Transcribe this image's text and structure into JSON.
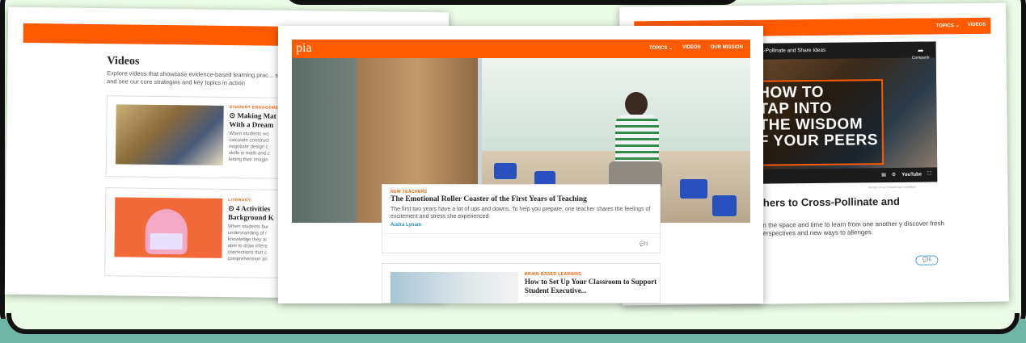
{
  "left_page": {
    "section_title": "Videos",
    "section_desc": "Explore videos that showcase evidence-based learning prac... schools, and see our core strategies and key topics in action",
    "cards": [
      {
        "category": "STUDENT ENGAGEMENT",
        "title_lines": [
          "⊙ Making Mat",
          "With a Dream"
        ],
        "text_lines": [
          "When students wo",
          "calculate construct",
          "negotiate design c",
          "skills in math and c",
          "letting their imagin"
        ]
      },
      {
        "category": "LITERACY",
        "title_lines": [
          "⊙ 4 Activities",
          "Background K"
        ],
        "text_lines": [
          "When students bui",
          "understanding of r",
          "knowledge they al",
          "able to draw infere",
          "connections that c",
          "comprehension an"
        ]
      }
    ]
  },
  "center_page": {
    "logo": "pia",
    "nav": [
      "TOPICS ⌄",
      "VIDEOS",
      "OUR MISSION"
    ],
    "featured": {
      "category": "NEW TEACHERS",
      "title": "The Emotional Roller Coaster of the First Years of Teaching",
      "text": "The first two years have a lot of ups and downs. To help you prepare, one teacher shares the feelings of excitement and stress she experienced.",
      "author": "Audra Lynam",
      "comments": "1"
    },
    "second": {
      "category": "BRAIN-BASED LEARNING",
      "title": "How to Set Up Your Classroom to Support Student Executive..."
    }
  },
  "right_page": {
    "nav": [
      "TOPICS ⌄",
      "VIDEOS"
    ],
    "video": {
      "top_title": "Cross-Pollinate and Share Ideas",
      "share_label": "Compartir",
      "big_text": "HOW TO\nTAP INTO\nTHE WISDOM\nF YOUR PEERS",
      "youtube_label": "YouTube",
      "credit": "George Lucas Educational Foundation"
    },
    "headline": "chers to Cross-Pollinate and",
    "text": "en the space and time to learn from one another y discover fresh perspectives and new ways to allenges.",
    "comments": "6"
  },
  "colors": {
    "accent": "#ff5a00",
    "link": "#2b8cc4",
    "frame": "#eafbe6"
  }
}
